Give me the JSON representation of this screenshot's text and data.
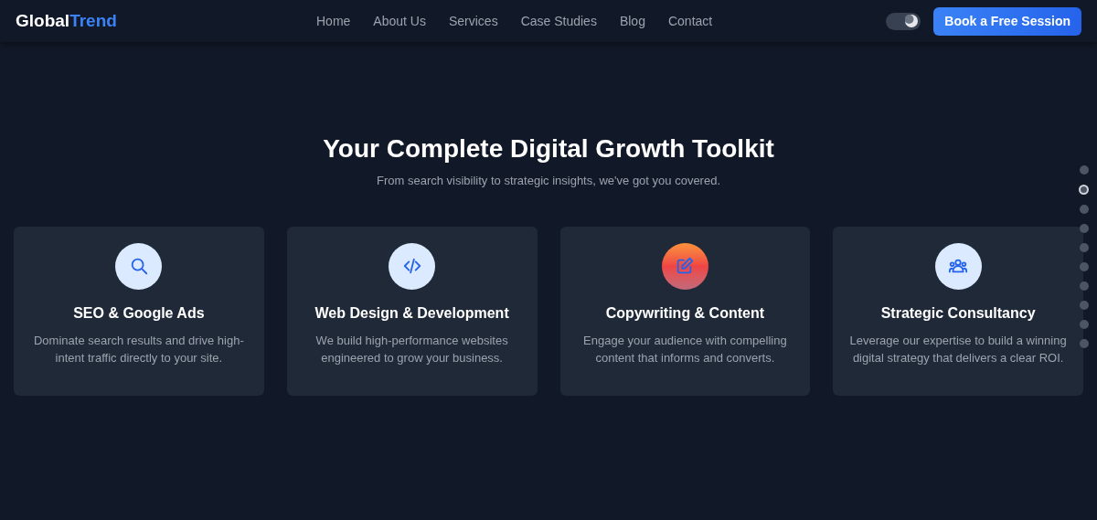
{
  "logo": {
    "part_1": "Global",
    "part_2": "Trend"
  },
  "nav": [
    {
      "label": "Home"
    },
    {
      "label": "About Us"
    },
    {
      "label": "Services"
    },
    {
      "label": "Case Studies"
    },
    {
      "label": "Blog"
    },
    {
      "label": "Contact"
    }
  ],
  "theme_toggle": {
    "on": true
  },
  "cta_button": "Book a Free Session",
  "section": {
    "title": "Your Complete Digital Growth Toolkit",
    "subtitle": "From search visibility to strategic insights, we've got you covered."
  },
  "cards": [
    {
      "kind": "search",
      "title": "SEO & Google Ads",
      "text": "Dominate search results and drive high-intent traffic directly to your site.",
      "selected": false
    },
    {
      "kind": "code",
      "title": "Web Design & Development",
      "text": "We build high-performance websites engineered to grow your business.",
      "selected": false
    },
    {
      "kind": "edit",
      "title": "Copywriting & Content",
      "text": "Engage your audience with compelling content that informs and converts.",
      "selected": true
    },
    {
      "kind": "users",
      "title": "Strategic Consultancy",
      "text": "Leverage our expertise to build a winning digital strategy that delivers a clear ROI.",
      "selected": false
    }
  ],
  "page_dots": [
    {
      "selected": false
    },
    {
      "selected": true
    },
    {
      "selected": false
    },
    {
      "selected": false
    },
    {
      "selected": false
    },
    {
      "selected": false
    },
    {
      "selected": false
    },
    {
      "selected": false
    },
    {
      "selected": false
    },
    {
      "selected": false
    }
  ]
}
